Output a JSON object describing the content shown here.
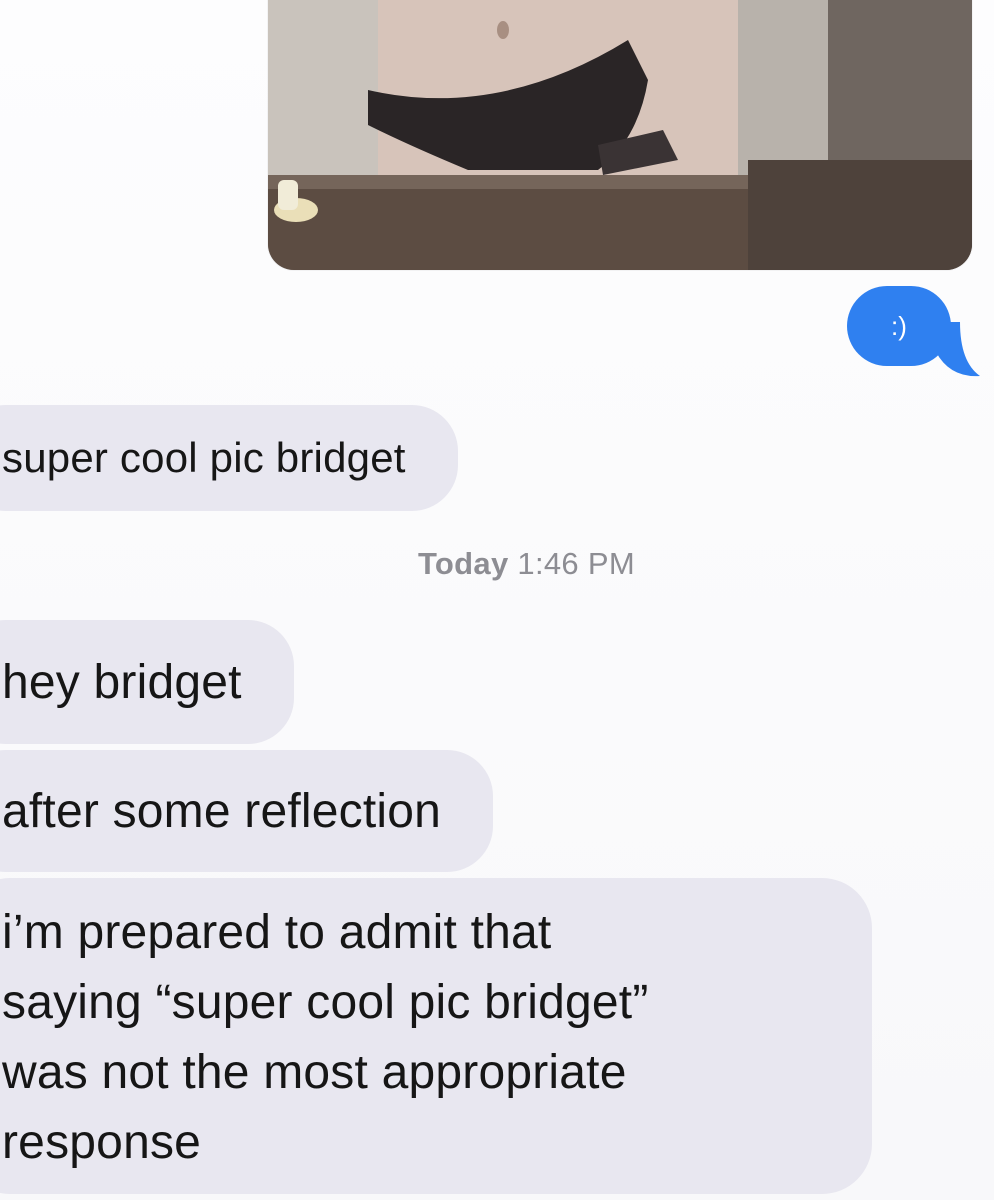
{
  "messages": {
    "outgoing_photo": {
      "kind": "photo attachment"
    },
    "outgoing_text": ":)",
    "incoming_1": "super cool pic bridget",
    "timestamp": {
      "day": "Today",
      "time": "1:46 PM"
    },
    "incoming_2": "hey bridget",
    "incoming_3": "after some reflection",
    "incoming_4_lines": [
      "i’m prepared to admit that",
      "saying “super cool pic bridget”",
      "was not the most appropriate",
      "response"
    ]
  },
  "colors": {
    "outgoing_bubble": "#2f80f0",
    "incoming_bubble": "#e8e7f0",
    "timestamp_text": "#8d8d93",
    "background": "#fdfdfe"
  }
}
